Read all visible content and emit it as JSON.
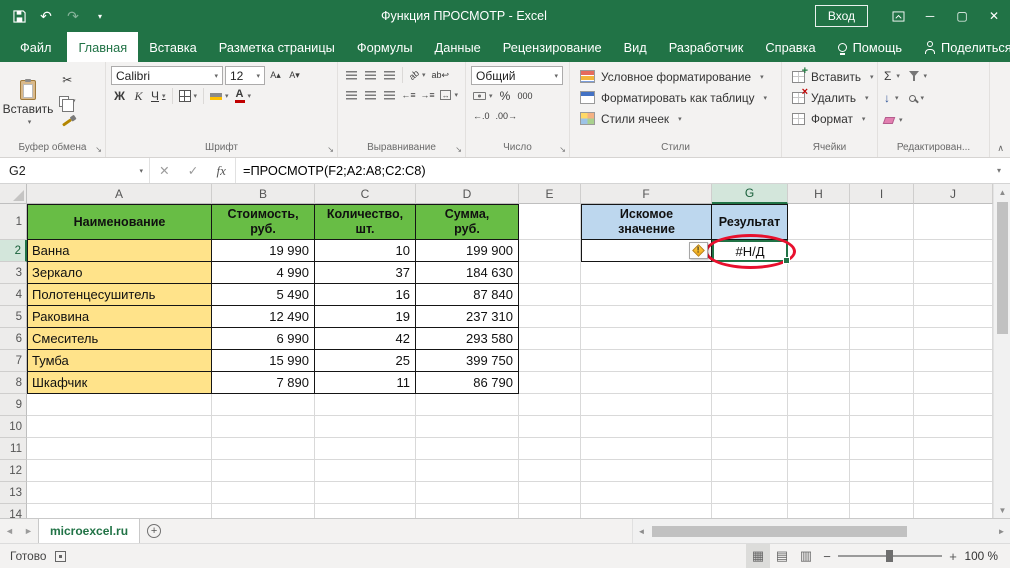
{
  "window": {
    "title": "Функция ПРОСМОТР  -  Excel",
    "sign_in": "Вход"
  },
  "glyphs": {
    "undo": "↶",
    "redo": "↷",
    "minimize": "─",
    "maximize": "▢",
    "close": "✕",
    "dropdown": "▾",
    "cancel": "✕",
    "enter": "✓",
    "fx": "fx",
    "expand_bar": "▾",
    "scroll_up": "▲",
    "scroll_down": "▼",
    "scroll_left": "◄",
    "scroll_right": "►",
    "new_sheet": "+",
    "zoom_out": "−",
    "zoom_in": "+",
    "view_normal": "▦",
    "view_layout": "▤",
    "view_break": "▥",
    "sigma": "Σ",
    "percent": "%",
    "thousands": "000",
    "inc_decimal": "←.0",
    "dec_decimal": ".00→",
    "cut": "✂",
    "wrap": "ab↩",
    "orientation": "ab",
    "merge": "↔",
    "font_up": "А▴",
    "font_down": "А▾",
    "fill_down": "↓",
    "indent_dec": "←≡",
    "indent_inc": "→≡",
    "collapse_ribbon": "∧",
    "launcher": "↘",
    "error_mark": "!"
  },
  "menu_tabs": {
    "file": "Файл",
    "items": [
      "Главная",
      "Вставка",
      "Разметка страницы",
      "Формулы",
      "Данные",
      "Рецензирование",
      "Вид",
      "Разработчик",
      "Справка"
    ],
    "active": "Главная",
    "help": "Помощь",
    "share": "Поделиться"
  },
  "ribbon": {
    "clipboard": {
      "label": "Буфер обмена",
      "paste": "Вставить"
    },
    "font": {
      "label": "Шрифт",
      "family": "Calibri",
      "size": "12",
      "bold": "Ж",
      "italic": "К",
      "underline": "Ч"
    },
    "alignment": {
      "label": "Выравнивание"
    },
    "number": {
      "label": "Число",
      "format": "Общий"
    },
    "styles": {
      "label": "Стили",
      "items": [
        "Условное форматирование",
        "Форматировать как таблицу",
        "Стили ячеек"
      ]
    },
    "cells": {
      "label": "Ячейки",
      "items": [
        "Вставить",
        "Удалить",
        "Формат"
      ]
    },
    "editing": {
      "label": "Редактирован..."
    }
  },
  "formula_bar": {
    "name_box": "G2",
    "formula": "=ПРОСМОТР(F2;A2:A8;C2:C8)"
  },
  "grid": {
    "column_letters": [
      "A",
      "B",
      "C",
      "D",
      "E",
      "F",
      "G",
      "H",
      "I",
      "J"
    ],
    "visible_rows": 14,
    "headers": {
      "A": "Наименование",
      "B": "Стоимость,\nруб.",
      "C": "Количество,\nшт.",
      "D": "Сумма,\nруб.",
      "F": "Искомое\nзначение",
      "G": "Результат"
    },
    "items": [
      {
        "name": "Ванна",
        "price": "19 990",
        "qty": "10",
        "total": "199 900"
      },
      {
        "name": "Зеркало",
        "price": "4 990",
        "qty": "37",
        "total": "184 630"
      },
      {
        "name": "Полотенцесушитель",
        "price": "5 490",
        "qty": "16",
        "total": "87 840"
      },
      {
        "name": "Раковина",
        "price": "12 490",
        "qty": "19",
        "total": "237 310"
      },
      {
        "name": "Смеситель",
        "price": "6 990",
        "qty": "42",
        "total": "293 580"
      },
      {
        "name": "Тумба",
        "price": "15 990",
        "qty": "25",
        "total": "399 750"
      },
      {
        "name": "Шкафчик",
        "price": "7 890",
        "qty": "11",
        "total": "86 790"
      }
    ],
    "lookup_value": "",
    "result_value": "#Н/Д",
    "selected_cell": "G2"
  },
  "sheet_bar": {
    "tab": "microexcel.ru"
  },
  "status_bar": {
    "mode": "Готово",
    "zoom": "100 %"
  },
  "colors": {
    "accent_green": "#217346",
    "table_header_fill": "#68BD45",
    "name_column_fill": "#FFE38A",
    "result_header_fill": "#BDD7EE",
    "annotation_red": "#E8102E"
  }
}
